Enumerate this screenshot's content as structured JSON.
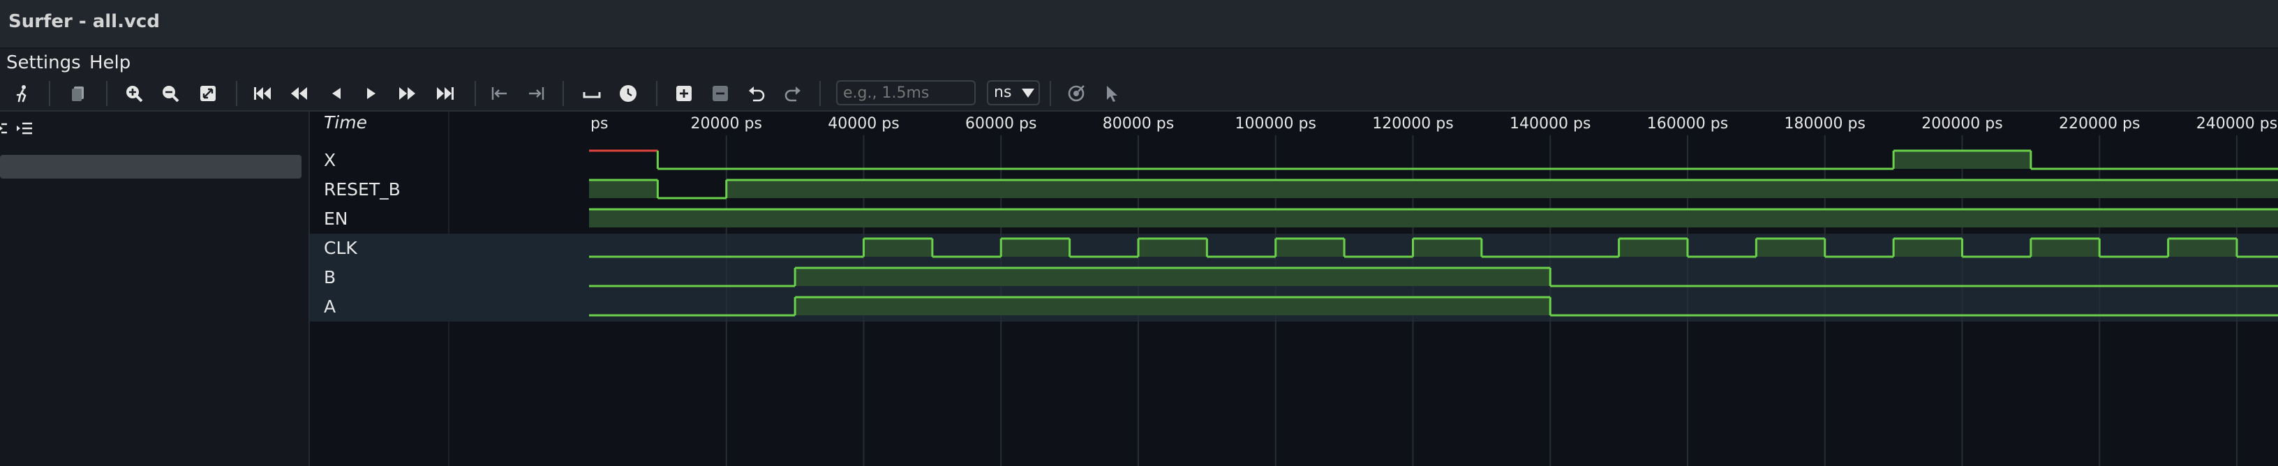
{
  "window": {
    "title": "Surfer - all.vcd"
  },
  "menu": {
    "items": [
      {
        "label": "Settings"
      },
      {
        "label": "Help"
      }
    ]
  },
  "toolbar": {
    "time_input_placeholder": "e.g., 1.5ms",
    "unit_value": "ns",
    "icons": [
      "quick-start-icon",
      "copy-icon",
      "zoom-in-icon",
      "zoom-out-icon",
      "zoom-fit-icon",
      "go-to-start-icon",
      "step-back-fast-icon",
      "step-back-icon",
      "play-icon",
      "step-forward-fast-icon",
      "go-to-end-icon",
      "prev-transition-icon",
      "next-transition-icon",
      "space-icon",
      "clock-icon",
      "add-icon",
      "remove-icon",
      "undo-icon",
      "redo-icon",
      "cursor-target-icon",
      "pointer-icon"
    ]
  },
  "names_panel": {
    "time_label": "Time",
    "signals": [
      "X",
      "RESET_B",
      "EN",
      "CLK",
      "B",
      "A"
    ]
  },
  "timeline": {
    "unit": "ps",
    "ticks": [
      {
        "label": "ps",
        "value": 0
      },
      {
        "label": "20000 ps",
        "value": 20000
      },
      {
        "label": "40000 ps",
        "value": 40000
      },
      {
        "label": "60000 ps",
        "value": 60000
      },
      {
        "label": "80000 ps",
        "value": 80000
      },
      {
        "label": "100000 ps",
        "value": 100000
      },
      {
        "label": "120000 ps",
        "value": 120000
      },
      {
        "label": "140000 ps",
        "value": 140000
      },
      {
        "label": "160000 ps",
        "value": 160000
      },
      {
        "label": "180000 ps",
        "value": 180000
      },
      {
        "label": "200000 ps",
        "value": 200000
      },
      {
        "label": "220000 ps",
        "value": 220000
      },
      {
        "label": "240000 ps",
        "value": 240000
      }
    ],
    "visible_end": 246000
  },
  "waveforms": [
    {
      "name": "X",
      "initial": "x",
      "changes": [
        [
          0,
          "x"
        ],
        [
          10000,
          0
        ],
        [
          190000,
          1
        ],
        [
          210000,
          0
        ]
      ]
    },
    {
      "name": "RESET_B",
      "initial": 1,
      "changes": [
        [
          0,
          1
        ],
        [
          10000,
          0
        ],
        [
          20000,
          1
        ]
      ]
    },
    {
      "name": "EN",
      "initial": 1,
      "changes": [
        [
          0,
          1
        ]
      ]
    },
    {
      "name": "CLK",
      "initial": 0,
      "changes": [
        [
          0,
          0
        ],
        [
          40000,
          1
        ],
        [
          50000,
          0
        ],
        [
          60000,
          1
        ],
        [
          70000,
          0
        ],
        [
          80000,
          1
        ],
        [
          90000,
          0
        ],
        [
          100000,
          1
        ],
        [
          110000,
          0
        ],
        [
          120000,
          1
        ],
        [
          130000,
          0
        ],
        [
          150000,
          1
        ],
        [
          160000,
          0
        ],
        [
          170000,
          1
        ],
        [
          180000,
          0
        ],
        [
          190000,
          1
        ],
        [
          200000,
          0
        ],
        [
          210000,
          1
        ],
        [
          220000,
          0
        ],
        [
          230000,
          1
        ],
        [
          240000,
          0
        ]
      ]
    },
    {
      "name": "B",
      "initial": 0,
      "changes": [
        [
          0,
          0
        ],
        [
          30000,
          1
        ],
        [
          140000,
          0
        ]
      ]
    },
    {
      "name": "A",
      "initial": 0,
      "changes": [
        [
          0,
          0
        ],
        [
          30000,
          1
        ],
        [
          140000,
          0
        ]
      ]
    }
  ],
  "colors": {
    "signal_green": "#6bd14a",
    "signal_fill": "#2b4a2d",
    "undefined_red": "#e0443e",
    "grid": "#262d36",
    "highlight_row": "#1b2630"
  }
}
